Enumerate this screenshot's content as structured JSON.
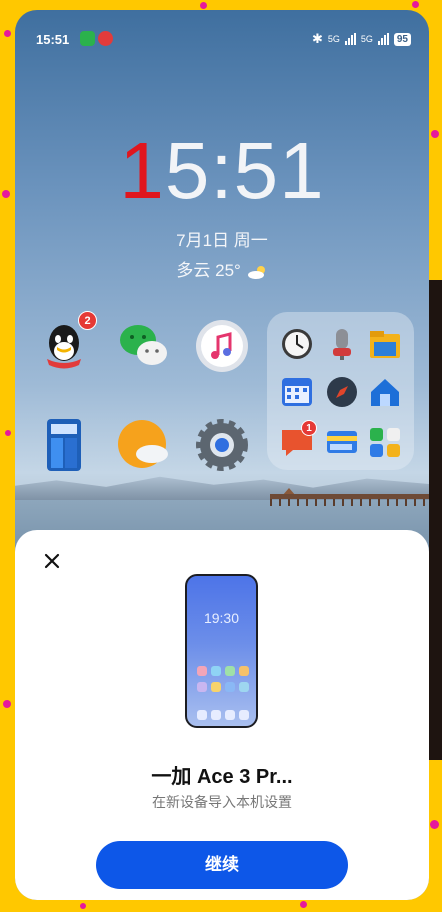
{
  "status_bar": {
    "time": "15:51",
    "network_1": "5G",
    "network_2": "5G",
    "battery": "95"
  },
  "lockscreen": {
    "clock_first": "1",
    "clock_rest": "5:51",
    "date": "7月1日  周一",
    "weather": "多云 25°"
  },
  "apps": {
    "qq_badge": "2",
    "message_badge": "1"
  },
  "sheet": {
    "mock_time": "19:30",
    "device_name": "一加 Ace 3 Pr...",
    "subtitle": "在新设备导入本机设置",
    "continue_label": "继续"
  },
  "colors": {
    "primary_button": "#0d57e8",
    "background_frame": "#ffc800",
    "clock_accent": "#e0161e"
  }
}
